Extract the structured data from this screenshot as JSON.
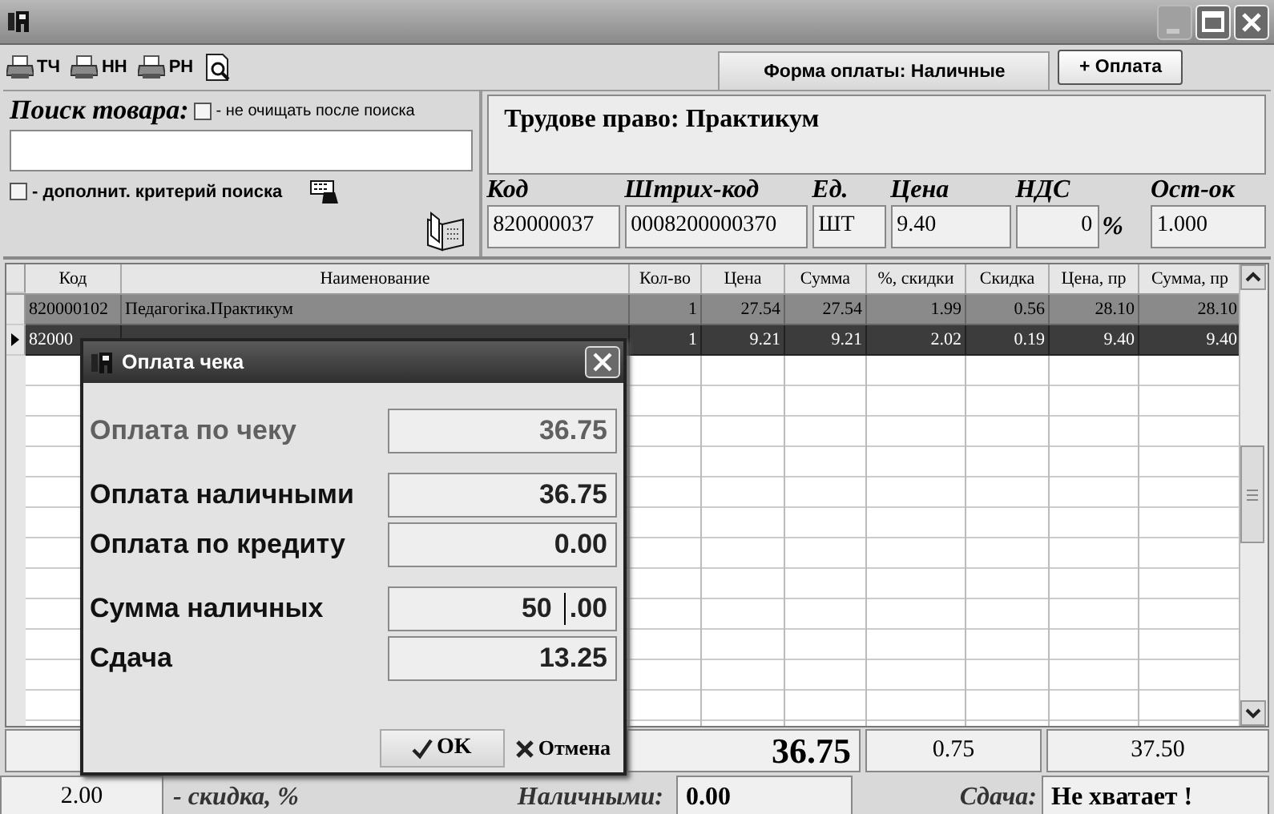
{
  "toolbar": {
    "print_buttons": [
      {
        "label": "ТЧ"
      },
      {
        "label": "НН"
      },
      {
        "label": "РН"
      }
    ],
    "payment_form": "Форма оплаты: Наличные",
    "add_payment_button": "+ Оплата"
  },
  "search": {
    "label": "Поиск товара:",
    "keep_option": {
      "label": "- не очищать после поиска",
      "checked": false
    },
    "extra_option": {
      "label": "- дополнит. критерий поиска",
      "checked": false
    }
  },
  "product": {
    "title": "Трудове право: Практикум",
    "fields": [
      {
        "label": "Код",
        "value": "820000037"
      },
      {
        "label": "Штрих-код",
        "value": "0008200000370"
      },
      {
        "label": "Ед.",
        "value": "ШТ"
      },
      {
        "label": "Цена",
        "value": "9.40"
      },
      {
        "label": "НДС",
        "value": "0",
        "suffix": "%"
      },
      {
        "label": "Ост-ок",
        "value": "1.000"
      }
    ]
  },
  "table": {
    "columns": [
      "Код",
      "Наименование",
      "Кол-во",
      "Цена",
      "Сумма",
      "%, скидки",
      "Скидка",
      "Цена, пр",
      "Сумма, пр"
    ],
    "rows": [
      {
        "selected": true,
        "current": false,
        "code": "820000102",
        "name": "Педагогіка.Практикум",
        "values": [
          "1",
          "27.54",
          "27.54",
          "1.99",
          "0.56",
          "28.10",
          "28.10"
        ]
      },
      {
        "selected": true,
        "current": true,
        "code": "82000",
        "values": [
          "1",
          "9.21",
          "9.21",
          "2.02",
          "0.19",
          "9.40",
          "9.40"
        ]
      }
    ]
  },
  "totals": {
    "sum": "36.75",
    "discount": "0.75",
    "total": "37.50",
    "discount_pct": "2.00",
    "discount_label": "- скидка, %",
    "cash_label": "Наличными:",
    "cash": "0.00",
    "change_label": "Сдача:",
    "change": "Не хватает !"
  },
  "dialog": {
    "title": "Оплата чека",
    "groups": [
      [
        {
          "label": "Оплата по чеку",
          "value": "36.75",
          "disabled": true
        }
      ],
      [
        {
          "label": "Оплата наличными",
          "value": "36.75",
          "disabled": false
        },
        {
          "label": "Оплата по кредиту",
          "value": "0.00",
          "disabled": false
        }
      ],
      [
        {
          "label": "Сумма наличных",
          "value": "50",
          "fraction": ".00",
          "disabled": false
        },
        {
          "label": "Сдача",
          "value": "13.25",
          "disabled": false
        }
      ]
    ],
    "ok_button": "OK",
    "cancel_button": "Отмена"
  }
}
